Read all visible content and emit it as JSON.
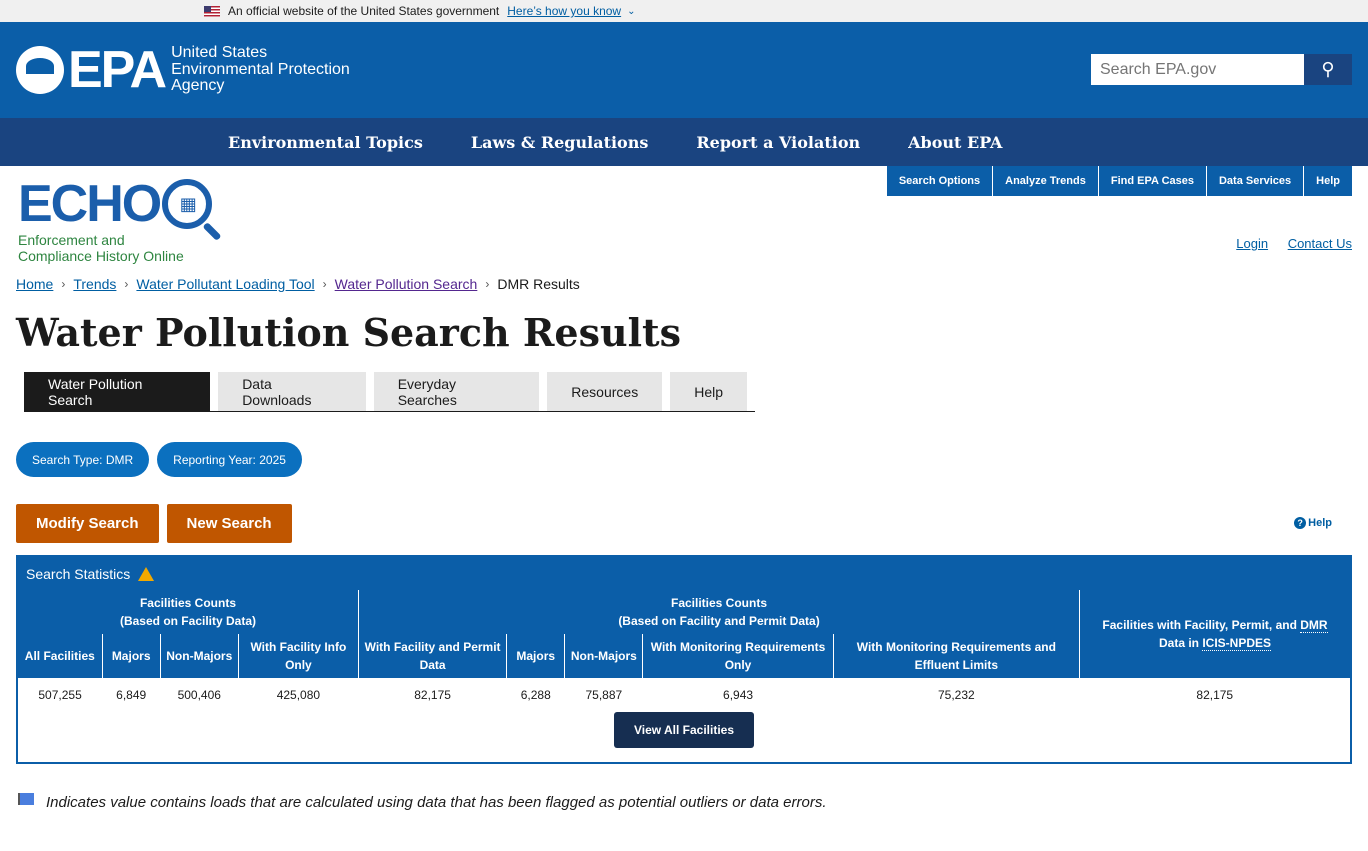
{
  "gov_banner": {
    "text": "An official website of the United States government",
    "link": "Here’s how you know"
  },
  "header": {
    "logo": "EPA",
    "agency_line1": "United States",
    "agency_line2": "Environmental Protection",
    "agency_line3": "Agency",
    "search_placeholder": "Search EPA.gov"
  },
  "nav": {
    "items": [
      "Environmental Topics",
      "Laws & Regulations",
      "Report a Violation",
      "About EPA"
    ]
  },
  "echo": {
    "logo": "ECHO",
    "sub1": "Enforcement and",
    "sub2": "Compliance History Online",
    "tabs": [
      "Search Options",
      "Analyze Trends",
      "Find EPA Cases",
      "Data Services",
      "Help"
    ],
    "login": "Login",
    "contact": "Contact Us"
  },
  "breadcrumb": [
    "Home",
    "Trends",
    "Water Pollutant Loading Tool",
    "Water Pollution Search",
    "DMR Results"
  ],
  "page_title": "Water Pollution Search Results",
  "tabs": [
    "Water Pollution Search",
    "Data Downloads",
    "Everyday Searches",
    "Resources",
    "Help"
  ],
  "pills": [
    "Search Type: DMR",
    "Reporting Year: 2025"
  ],
  "actions": {
    "modify": "Modify Search",
    "new": "New Search",
    "help": "Help"
  },
  "stats": {
    "title": "Search Statistics",
    "group1_a": "Facilities Counts",
    "group1_b": "(Based on Facility Data)",
    "group2_a": "Facilities Counts",
    "group2_b": "(Based on Facility and Permit Data)",
    "group3_a": "Facilities with Facility, Permit, and",
    "group3_dmr": "DMR",
    "group3_b": "Data in",
    "group3_icis": "ICIS-NPDES",
    "columns": [
      "All Facilities",
      "Majors",
      "Non-Majors",
      "With Facility Info Only",
      "With Facility and Permit Data",
      "Majors",
      "Non-Majors",
      "With Monitoring Requirements Only",
      "With Monitoring Requirements and Effluent Limits"
    ],
    "values": [
      "507,255",
      "6,849",
      "500,406",
      "425,080",
      "82,175",
      "6,288",
      "75,887",
      "6,943",
      "75,232",
      "82,175"
    ],
    "view_all": "View All Facilities"
  },
  "footnote": "Indicates value contains loads that are calculated using data that has been flagged as potential outliers or data errors."
}
